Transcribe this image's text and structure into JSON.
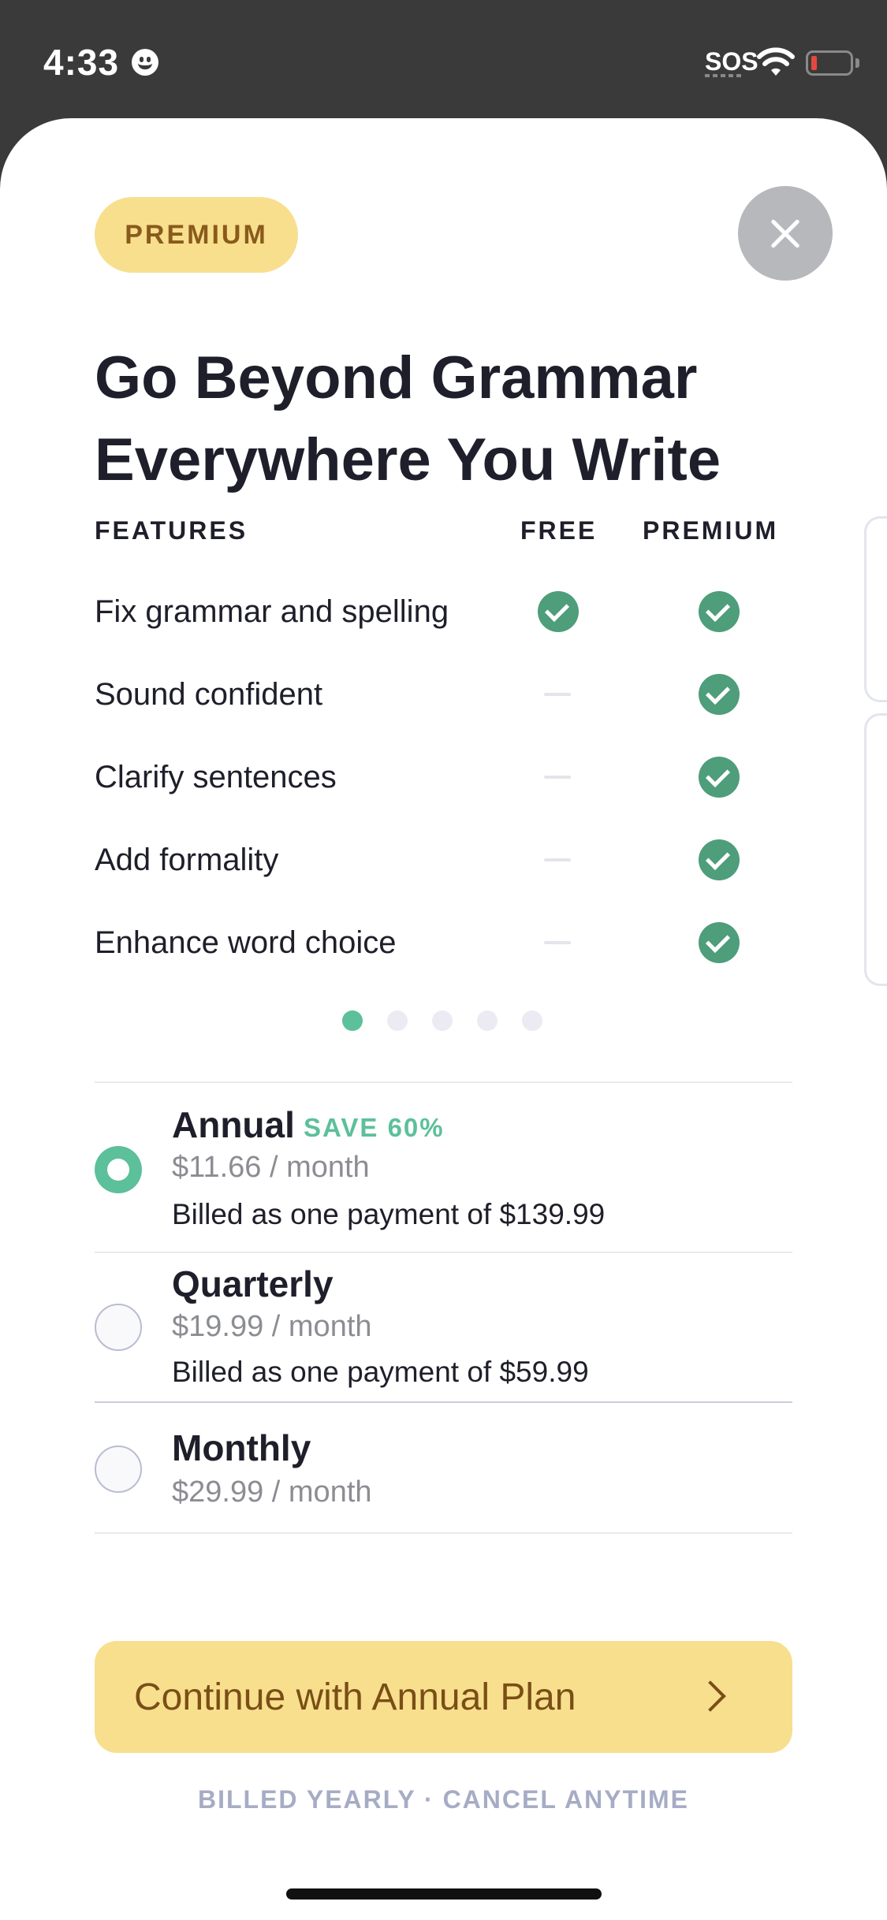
{
  "status_bar": {
    "time": "4:33",
    "sos": "SOS",
    "icons": [
      "smiley-icon",
      "wifi-icon",
      "battery-icon"
    ],
    "battery_color": "#e5483f"
  },
  "badge": "PREMIUM",
  "headline": "Go Beyond Grammar Everywhere You Write",
  "features_table": {
    "headers": {
      "feature": "FEATURES",
      "free": "FREE",
      "premium": "PREMIUM"
    },
    "rows": [
      {
        "label": "Fix grammar and spelling",
        "free": true,
        "premium": true
      },
      {
        "label": "Sound confident",
        "free": false,
        "premium": true
      },
      {
        "label": "Clarify sentences",
        "free": false,
        "premium": true
      },
      {
        "label": "Add formality",
        "free": false,
        "premium": true
      },
      {
        "label": "Enhance word choice",
        "free": false,
        "premium": true
      }
    ]
  },
  "pagination": {
    "count": 5,
    "active": 1
  },
  "plans": [
    {
      "name": "Annual",
      "tag": "SAVE 60%",
      "price": "$11.66 / month",
      "billed": "Billed as one payment of $139.99",
      "selected": true
    },
    {
      "name": "Quarterly",
      "price": "$19.99 / month",
      "billed": "Billed as one payment of $59.99",
      "selected": false
    },
    {
      "name": "Monthly",
      "price": "$29.99 / month",
      "selected": false
    }
  ],
  "cta": {
    "label": "Continue with Annual Plan"
  },
  "footnote": "BILLED YEARLY · CANCEL ANYTIME",
  "colors": {
    "accent_green": "#5cc09a",
    "check_green": "#4e9d7b",
    "premium_yellow": "#f7df8e",
    "premium_text": "#8a5a1c"
  }
}
